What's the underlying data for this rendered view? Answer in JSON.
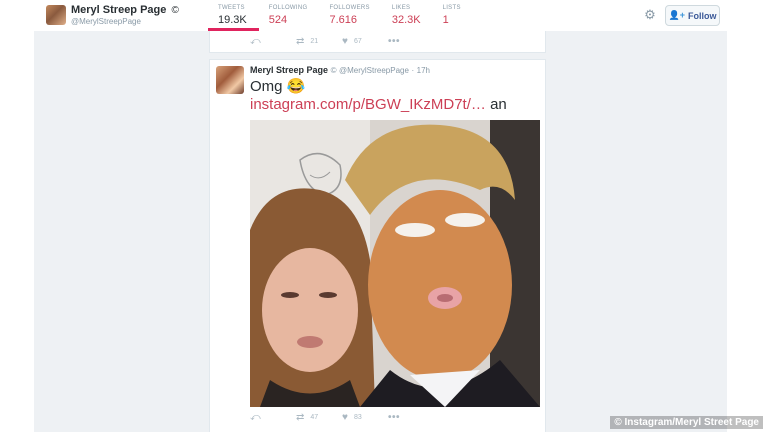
{
  "profile": {
    "name": "Meryl Streep Page",
    "badge": "©",
    "handle": "@MerylStreepPage"
  },
  "nav": [
    {
      "label": "TWEETS",
      "value": "19.3K",
      "active": true
    },
    {
      "label": "FOLLOWING",
      "value": "524",
      "active": false
    },
    {
      "label": "FOLLOWERS",
      "value": "7.616",
      "active": false
    },
    {
      "label": "LIKES",
      "value": "32.3K",
      "active": false
    },
    {
      "label": "LISTS",
      "value": "1",
      "active": false
    }
  ],
  "follow_button": {
    "label": "Follow",
    "icon": "add-user-icon"
  },
  "settings_icon": "gear-icon",
  "prev_tweet": {
    "reply_icon": "reply-icon",
    "retweets": "21",
    "likes": "67",
    "more_icon": "more-icon"
  },
  "tweet": {
    "name": "Meryl Streep Page",
    "badge": "©",
    "handle": "@MerylStreepPage",
    "time": "17h",
    "text": "Omg 😂",
    "link": "instagram.com/p/BGW_IKzMD7t/",
    "link_ellipsis": "…",
    "link_after": " an",
    "retweets": "47",
    "likes": "83",
    "photo_description": "selfie-photo"
  },
  "credit": "© Instagram/Meryl Street Page",
  "colors": {
    "accent": "#e0245e",
    "link": "#cc3f55",
    "muted": "#8899a6"
  }
}
